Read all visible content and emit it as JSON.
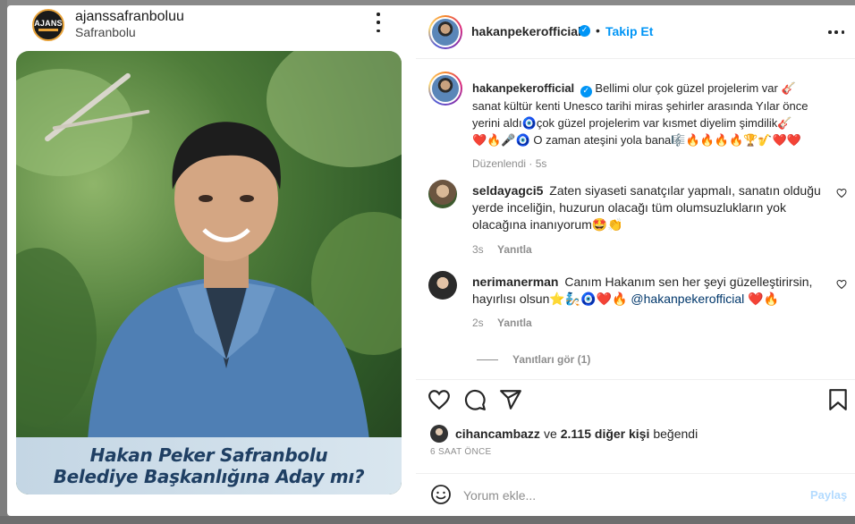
{
  "left_post": {
    "username": "ajanssafranboluu",
    "location": "Safranbolu",
    "logo_text": "AJANS",
    "image_caption_line1": "Hakan Peker Safranbolu",
    "image_caption_line2": "Belediye Başkanlığına Aday mı?"
  },
  "header": {
    "username": "hakanpekerofficial",
    "verified_icon": "verified-badge-icon",
    "separator": "•",
    "follow_label": "Takip Et"
  },
  "caption": {
    "username": "hakanpekerofficial",
    "line1": "Bellimi olur çok güzel projelerim var 🎸",
    "line2": "sanat kültür kenti Unesco tarihi miras şehirler arasında Yılar önce",
    "line3": "yerini aldı🧿çok güzel projelerim var kısmet diyelim şimdilik🎸",
    "line4": "❤️🔥🎤🧿 O zaman ateşini yola bana🎼🔥🔥🔥🔥🏆🎷❤️❤️",
    "edited_label": "Düzenlendi",
    "separator": "·",
    "time": "5s"
  },
  "comments": [
    {
      "username": "seldayagci5",
      "text": "Zaten siyaseti sanatçılar yapmalı, sanatın olduğu yerde inceliğin, huzurun olacağı tüm olumsuzlukların yok olacağına inanıyorum🤩👏",
      "time": "3s",
      "reply_label": "Yanıtla"
    },
    {
      "username": "nerimanerman",
      "text": "Canım Hakanım sen her şeyi güzelleştirirsin, hayırlısı olsun⭐🧞🧿❤️🔥",
      "mention": "@hakanpekerofficial",
      "text_after": "❤️🔥",
      "time": "2s",
      "reply_label": "Yanıtla"
    }
  ],
  "view_replies_label": "Yanıtları gör (1)",
  "likes": {
    "user": "cihancambazz",
    "conjunction": "ve",
    "others": "2.115 diğer kişi",
    "suffix": "beğendi"
  },
  "time_ago": "6 SAAT ÖNCE",
  "comment_box": {
    "placeholder": "Yorum ekle...",
    "post_label": "Paylaş"
  },
  "colors": {
    "link_blue": "#0095f6",
    "caption_text": "#1f3f63",
    "muted": "#8e8e8e"
  }
}
